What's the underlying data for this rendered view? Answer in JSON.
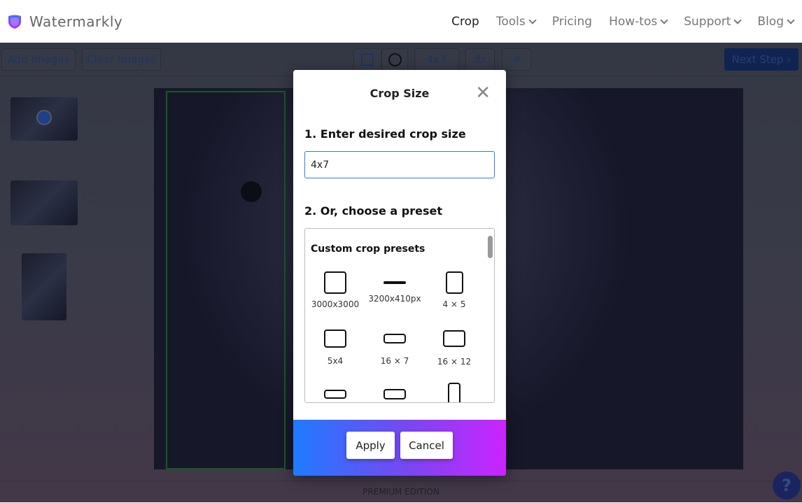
{
  "brand": {
    "name": "Watermarkly"
  },
  "nav": {
    "items": [
      {
        "label": "Crop",
        "dropdown": false
      },
      {
        "label": "Tools",
        "dropdown": true
      },
      {
        "label": "Pricing",
        "dropdown": false
      },
      {
        "label": "How-tos",
        "dropdown": true
      },
      {
        "label": "Support",
        "dropdown": true
      },
      {
        "label": "Blog",
        "dropdown": true
      }
    ]
  },
  "toolbar": {
    "add_images": "Add Images",
    "clear_images": "Clear Images",
    "ratio": "4x7",
    "next_step": "Next Step"
  },
  "footer": {
    "edition": "PREMIUM EDITION",
    "help": "?"
  },
  "modal": {
    "title": "Crop Size",
    "step1": "1. Enter desired crop size",
    "input_value": "4x7",
    "step2": "2. Or, choose a preset",
    "presets_title": "Custom crop presets",
    "presets": [
      {
        "label": "3000x3000"
      },
      {
        "label": "3200x410px"
      },
      {
        "label": "4 × 5"
      },
      {
        "label": "5x4"
      },
      {
        "label": "16 × 7"
      },
      {
        "label": "16 × 12"
      },
      {
        "label": ""
      },
      {
        "label": ""
      },
      {
        "label": ""
      }
    ],
    "apply": "Apply",
    "cancel": "Cancel"
  },
  "colors": {
    "accent": "#3a78d8",
    "gradient_start": "#1e7bff",
    "gradient_end": "#cb24ff"
  }
}
